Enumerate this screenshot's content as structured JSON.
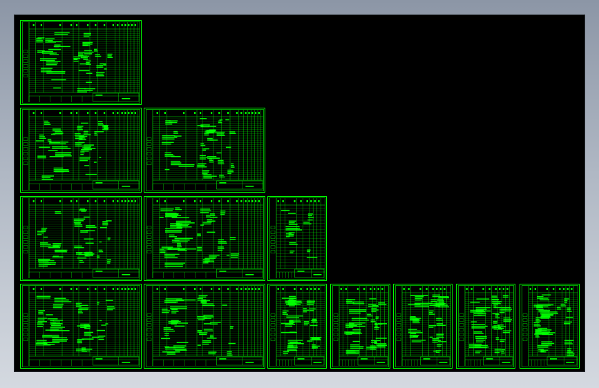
{
  "viewport": {
    "background_top": "#8c96a6",
    "background_bottom": "#d4d9e0",
    "canvas_color": "#000000",
    "line_color": "#00ff00"
  },
  "sheets": [
    {
      "id": "sheet-1",
      "kind": "a3"
    },
    {
      "id": "sheet-2",
      "kind": "a3"
    },
    {
      "id": "sheet-3",
      "kind": "a3"
    },
    {
      "id": "sheet-4",
      "kind": "a3"
    },
    {
      "id": "sheet-5",
      "kind": "a3"
    },
    {
      "id": "sheet-6",
      "kind": "a4",
      "sparse": true
    },
    {
      "id": "sheet-7",
      "kind": "a3"
    },
    {
      "id": "sheet-8",
      "kind": "a3"
    },
    {
      "id": "sheet-9",
      "kind": "a4"
    },
    {
      "id": "sheet-10",
      "kind": "a4"
    },
    {
      "id": "sheet-11",
      "kind": "a4"
    },
    {
      "id": "sheet-12",
      "kind": "a4"
    },
    {
      "id": "sheet-13",
      "kind": "a4"
    }
  ]
}
